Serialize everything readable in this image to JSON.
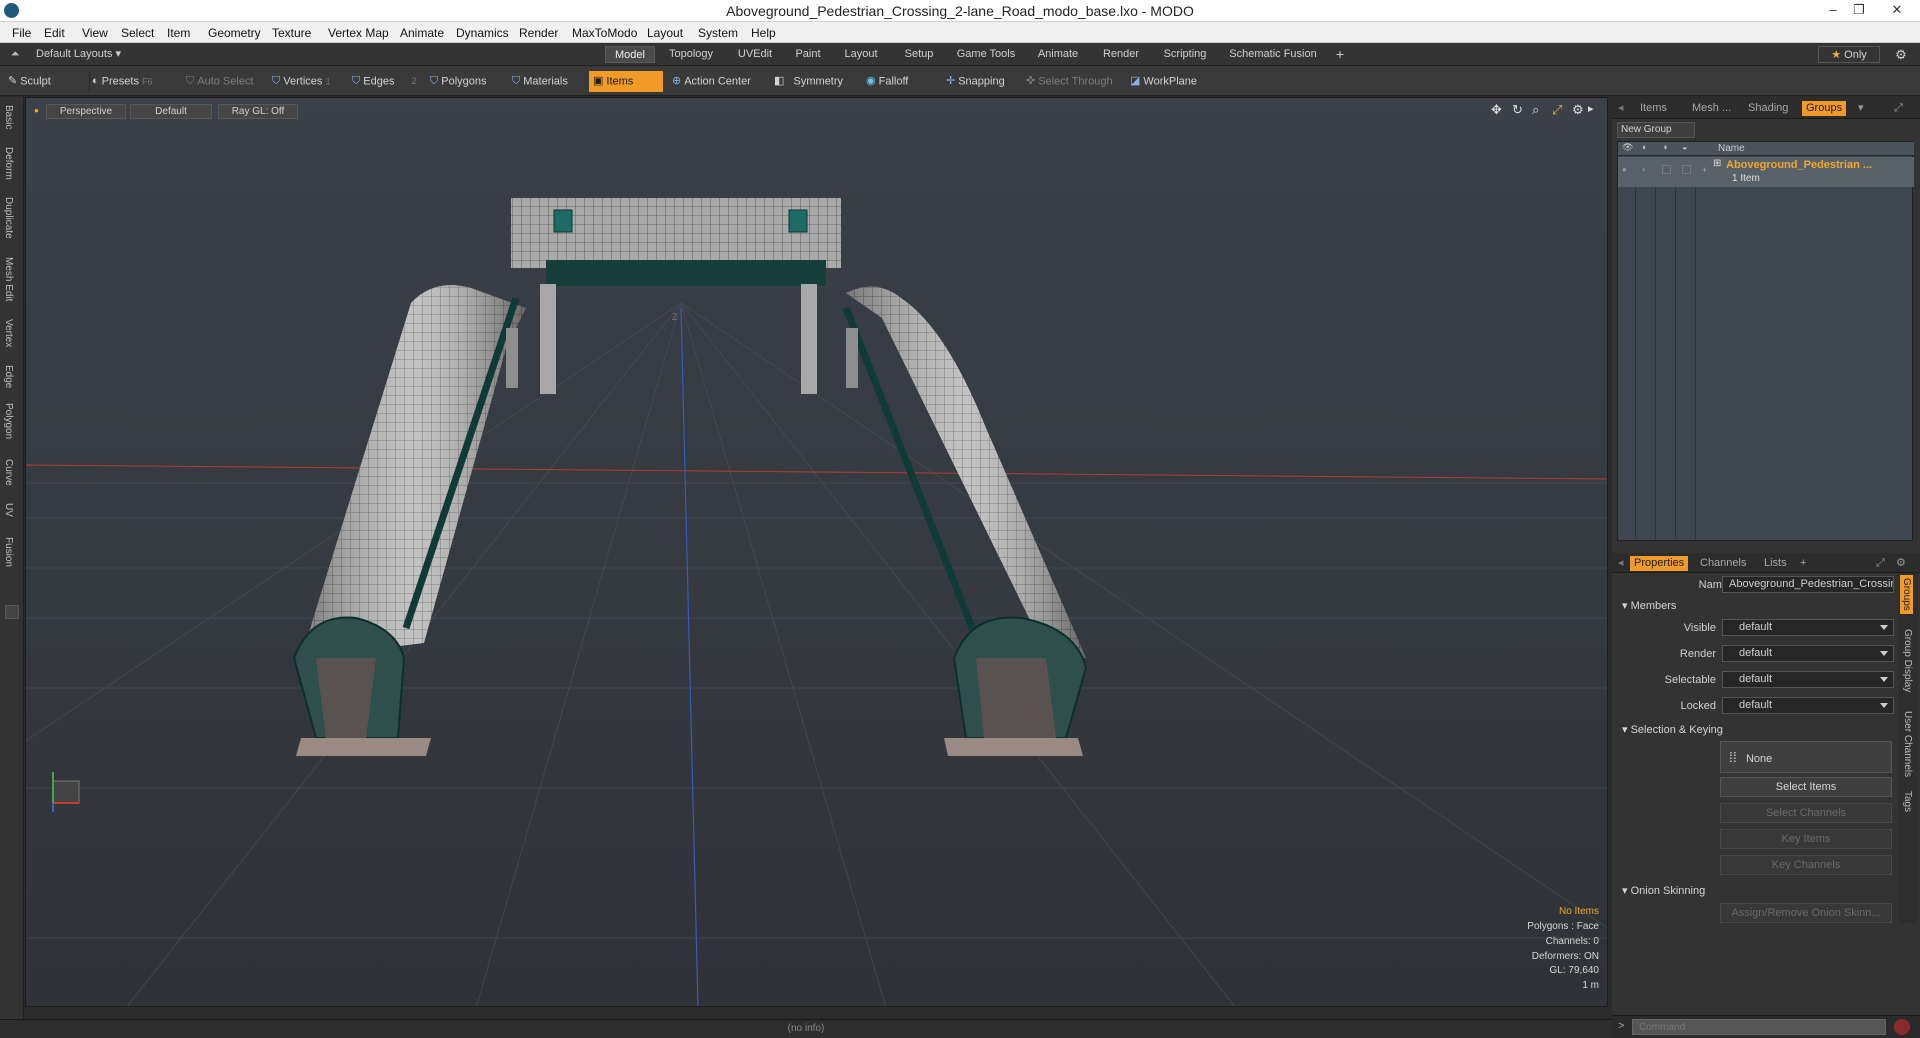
{
  "window": {
    "title": "Aboveground_Pedestrian_Crossing_2-lane_Road_modo_base.lxo - MODO",
    "min": "–",
    "max": "❐",
    "close": "✕"
  },
  "menu": [
    "File",
    "Edit",
    "View",
    "Select",
    "Item",
    "Geometry",
    "Texture",
    "Vertex Map",
    "Animate",
    "Dynamics",
    "Render",
    "MaxToModo",
    "Layout",
    "System",
    "Help"
  ],
  "layoutbar": {
    "layout_label": "Default Layouts",
    "tabs": [
      "Model",
      "Topology",
      "UVEdit",
      "Paint",
      "Layout",
      "Setup",
      "Game Tools",
      "Animate",
      "Render",
      "Scripting",
      "Schematic Fusion"
    ],
    "active_tab": "Model",
    "plus": "+",
    "only_label": "Only"
  },
  "toolbar": {
    "sculpt": "Sculpt",
    "presets": "Presets",
    "presets_key": "F6",
    "auto_select": "Auto Select",
    "vertices": "Vertices",
    "vertices_count": "1",
    "edges": "Edges",
    "edges_count": "2",
    "polygons": "Polygons",
    "materials": "Materials",
    "items": "Items",
    "action_center": "Action Center",
    "symmetry": "Symmetry",
    "falloff": "Falloff",
    "snapping": "Snapping",
    "select_through": "Select Through",
    "workplane": "WorkPlane"
  },
  "lefttabs": [
    "Basic",
    "Deform",
    "Duplicate",
    "Mesh Edit",
    "Vertex",
    "Edge",
    "Polygon",
    "Curve",
    "UV",
    "Fusion"
  ],
  "viewport": {
    "view": "Perspective",
    "shading": "Default",
    "raygl": "Ray GL: Off",
    "axis_label": "Z",
    "stats": {
      "selection": "No Items",
      "polygons": "Polygons : Face",
      "channels": "Channels: 0",
      "deformers": "Deformers: ON",
      "gl": "GL: 79,640",
      "unit": "1 m"
    }
  },
  "status": {
    "info": "(no info)"
  },
  "groups_panel": {
    "tabs": [
      "Items",
      "Mesh ...",
      "Shading",
      "Groups"
    ],
    "active_tab": "Groups",
    "new_group": "New Group",
    "name_header": "Name",
    "group_name": "Aboveground_Pedestrian ...",
    "group_count": "1 Item"
  },
  "properties_panel": {
    "tabs": [
      "Properties",
      "Channels",
      "Lists"
    ],
    "active_tab": "Properties",
    "plus": "+",
    "name_label": "Name",
    "name_value": "Aboveground_Pedestrian_Crossir",
    "members_section": "Members",
    "fields": [
      {
        "label": "Visible",
        "value": "default"
      },
      {
        "label": "Render",
        "value": "default"
      },
      {
        "label": "Selectable",
        "value": "default"
      },
      {
        "label": "Locked",
        "value": "default"
      }
    ],
    "keying_section": "Selection & Keying",
    "none_label": "None",
    "select_items": "Select Items",
    "select_channels": "Select Channels",
    "key_items": "Key Items",
    "key_channels": "Key Channels",
    "onion_section": "Onion Skinning",
    "onion_button": "Assign/Remove Onion Skinn...",
    "side_tabs": [
      "Groups",
      "Group Display",
      "User Channels",
      "Tags"
    ]
  },
  "command": {
    "placeholder": "Command",
    "prompt": ">"
  }
}
